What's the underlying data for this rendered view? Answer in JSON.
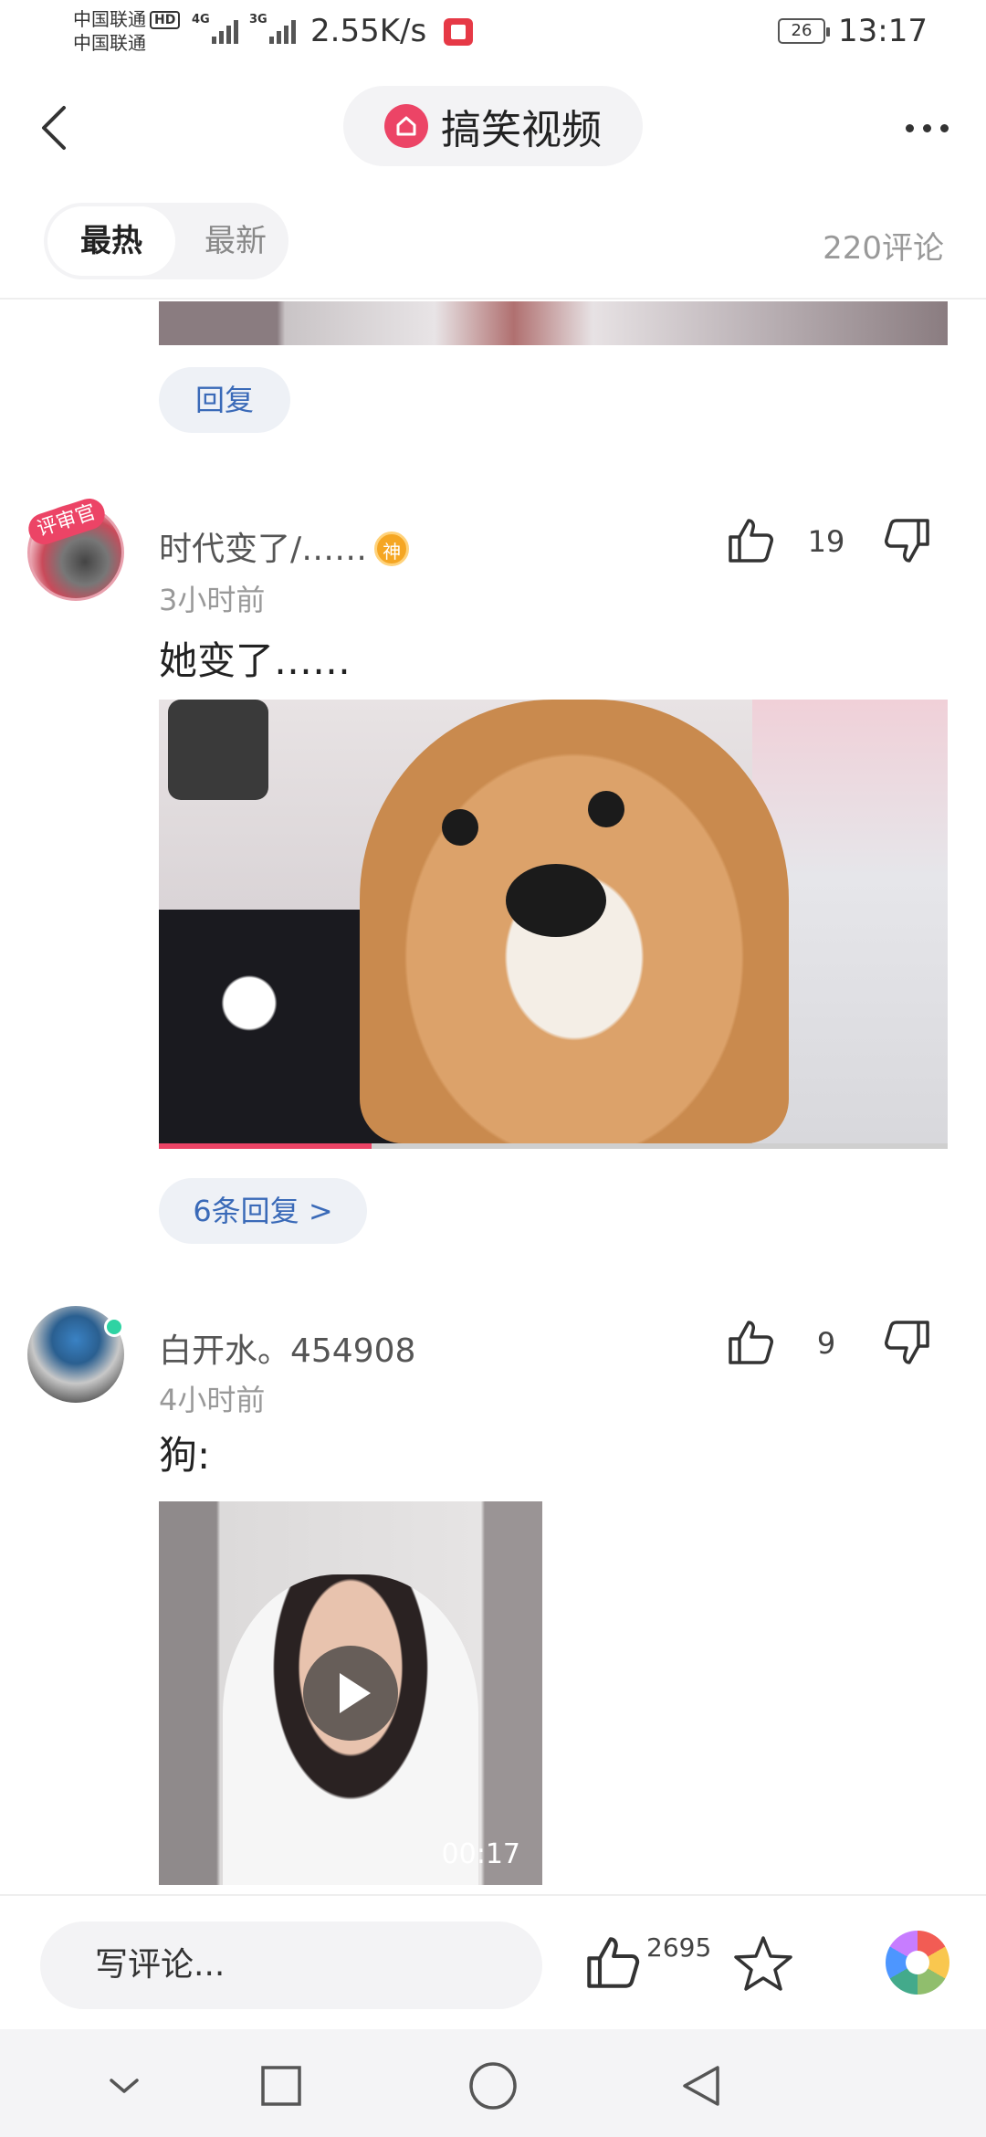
{
  "status_bar": {
    "carrier_1": "中国联通",
    "carrier_2": "中国联通",
    "hd_badge": "HD",
    "net_1": "4G",
    "net_2": "3G",
    "speed": "2.55K/s",
    "battery": "26",
    "time": "13:17"
  },
  "header": {
    "title": "搞笑视频",
    "back_icon": "chevron-left-icon",
    "more_icon": "more-dots-icon"
  },
  "sort": {
    "hot_label": "最热",
    "new_label": "最新",
    "selected": "最热",
    "comment_count": "220评论"
  },
  "previous": {
    "reply_label": "回复"
  },
  "comments": [
    {
      "avatar_badge": "评审官",
      "username": "时代变了/……",
      "god_badge": "神",
      "time": "3小时前",
      "text": "她变了……",
      "like_count": "19",
      "video_progress_fraction": 0.27,
      "replies_label": "6条回复 >"
    },
    {
      "username": "白开水。454908",
      "time": "4小时前",
      "text": "狗:",
      "like_count": "9",
      "video_duration": "00:17",
      "online": true
    }
  ],
  "bottom_bar": {
    "input_placeholder": "写评论...",
    "like_count": "2695",
    "like_icon": "thumbs-up-icon",
    "star_icon": "star-icon",
    "share_icon": "share-wheel-icon"
  },
  "colors": {
    "accent": "#ec4466",
    "link": "#3a6ab8",
    "online": "#2ed3a3"
  }
}
